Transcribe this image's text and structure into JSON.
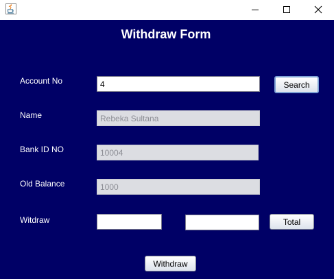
{
  "window": {
    "app_icon": "java-icon",
    "controls": {
      "minimize": "minimize-icon",
      "maximize": "maximize-icon",
      "close": "close-icon"
    }
  },
  "form": {
    "title": "Withdraw Form",
    "account_no_label": "Account No",
    "account_no_value": "4",
    "search_button": "Search",
    "name_label": "Name",
    "name_value": "Rebeka Sultana",
    "bank_id_label": "Bank ID NO",
    "bank_id_value": "10004",
    "old_balance_label": "Old Balance",
    "old_balance_value": "1000",
    "withdraw_label": "Witdraw",
    "withdraw_amount_value": "",
    "total_value": "",
    "total_button": "Total",
    "withdraw_button": "Withdraw"
  },
  "colors": {
    "panel_background": "#000066",
    "label_text": "#ffffff"
  }
}
